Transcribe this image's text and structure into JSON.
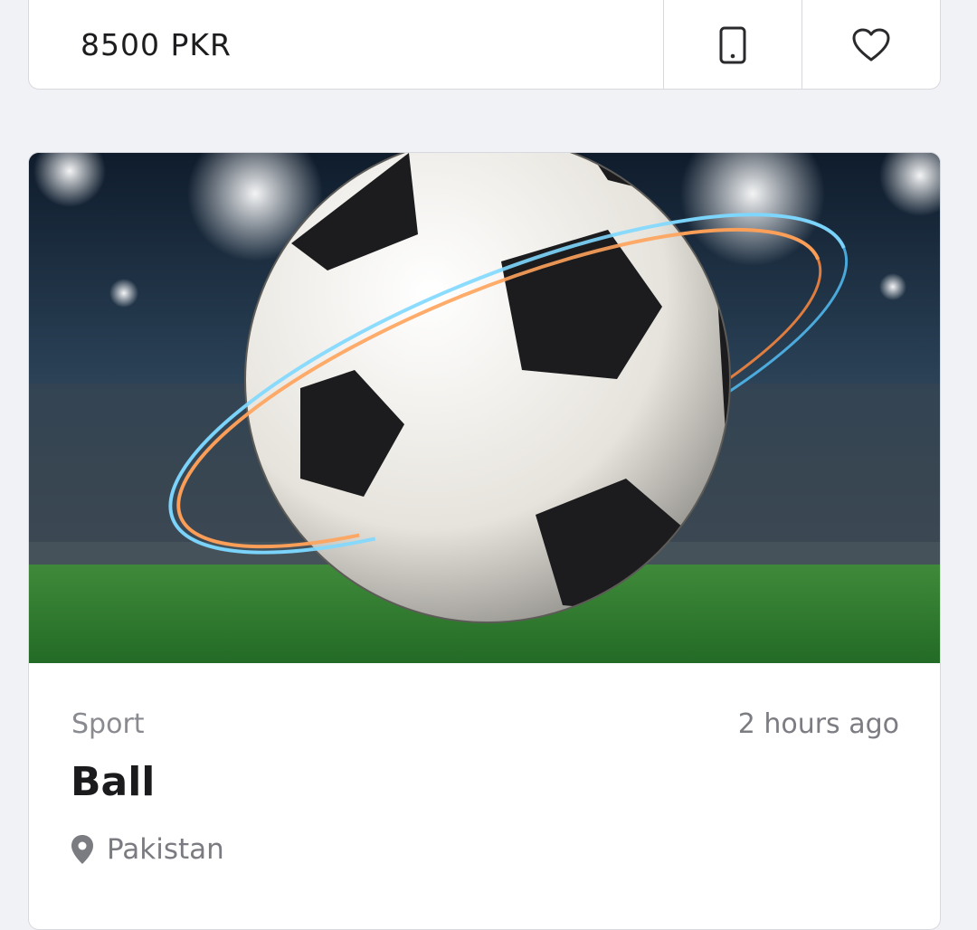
{
  "listing_top": {
    "price": "8500 PKR",
    "phone_icon": "phone-icon",
    "favorite_icon": "heart-icon"
  },
  "listing": {
    "image_subject": "soccer-ball",
    "category": "Sport",
    "time_posted": "2 hours ago",
    "title": "Ball",
    "location_icon": "location-pin-icon",
    "location": "Pakistan"
  },
  "colors": {
    "background": "#f1f2f6",
    "card": "#ffffff",
    "border": "#d8d9de",
    "title_text": "#1b1b1d",
    "muted_text": "#8a8b90"
  }
}
